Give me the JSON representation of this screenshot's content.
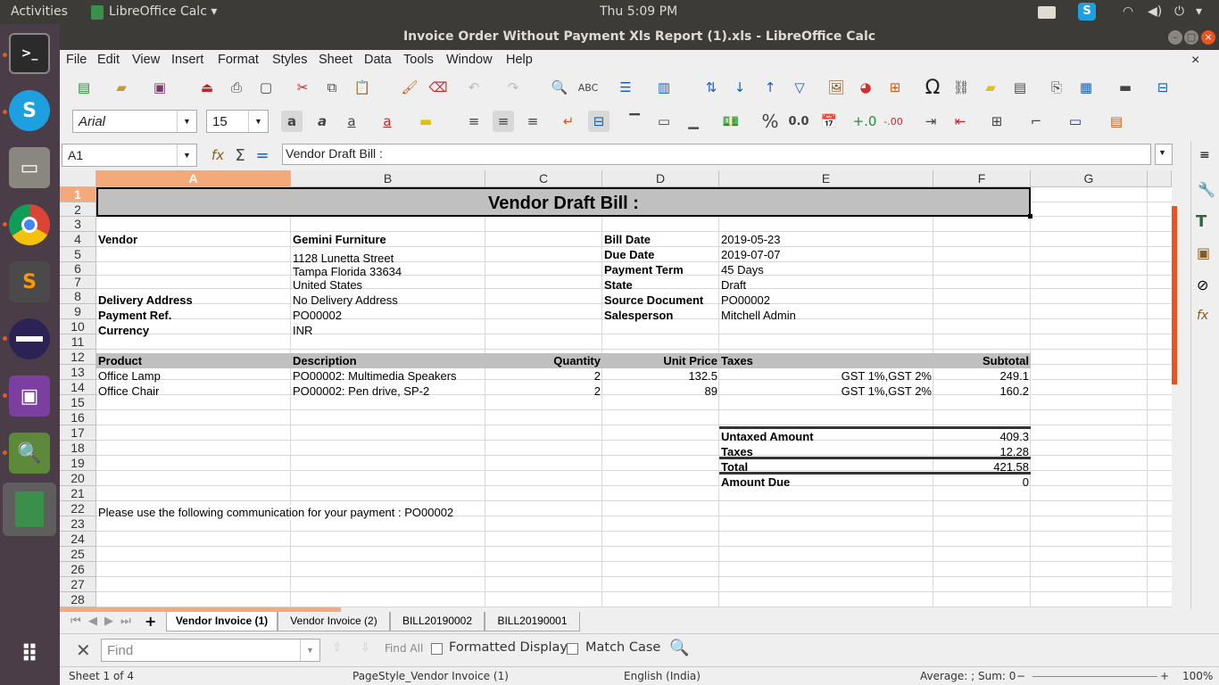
{
  "topbar": {
    "activities": "Activities",
    "app_menu": "LibreOffice Calc ▾",
    "clock": "Thu  5:09 PM"
  },
  "window": {
    "title": "Invoice Order Without Payment Xls Report (1).xls - LibreOffice Calc"
  },
  "menu": [
    "File",
    "Edit",
    "View",
    "Insert",
    "Format",
    "Styles",
    "Sheet",
    "Data",
    "Tools",
    "Window",
    "Help"
  ],
  "font_name": "Arial",
  "font_size": "15",
  "formula_bar": {
    "name_box": "A1",
    "content": "Vendor Draft Bill :"
  },
  "columns": [
    "A",
    "B",
    "C",
    "D",
    "E",
    "F",
    "G"
  ],
  "rows": [
    "1",
    "2",
    "3",
    "4",
    "5",
    "6",
    "7",
    "8",
    "9",
    "10",
    "11",
    "12",
    "13",
    "14",
    "15",
    "16",
    "17",
    "18",
    "19",
    "20",
    "21",
    "22",
    "23",
    "24",
    "25",
    "26",
    "27",
    "28"
  ],
  "sheet": {
    "title": "Vendor Draft Bill :",
    "vendor_label": "Vendor",
    "vendor_name": "Gemini Furniture",
    "address1": "1128 Lunetta Street",
    "address2": "Tampa Florida 33634",
    "address3": "United States",
    "delivery_label": "Delivery Address",
    "delivery_value": "No Delivery Address",
    "payref_label": "Payment Ref.",
    "payref_value": "PO00002",
    "currency_label": "Currency",
    "currency_value": "INR",
    "bill_date_label": "Bill Date",
    "bill_date": "2019-05-23",
    "due_date_label": "Due Date",
    "due_date": "2019-07-07",
    "term_label": "Payment Term",
    "term": "45 Days",
    "state_label": "State",
    "state": "Draft",
    "source_label": "Source Document",
    "source": "PO00002",
    "sales_label": "Salesperson",
    "sales": "Mitchell Admin",
    "headers": {
      "product": "Product",
      "description": "Description",
      "quantity": "Quantity",
      "unit_price": "Unit Price",
      "taxes": "Taxes",
      "subtotal": "Subtotal"
    },
    "lines": [
      {
        "product": "Office Lamp",
        "description": "PO00002: Multimedia Speakers",
        "quantity": "2",
        "unit_price": "132.5",
        "taxes": "GST 1%,GST 2%",
        "subtotal": "249.1"
      },
      {
        "product": "Office Chair",
        "description": "PO00002: Pen drive, SP-2",
        "quantity": "2",
        "unit_price": "89",
        "taxes": "GST 1%,GST 2%",
        "subtotal": "160.2"
      }
    ],
    "totals": [
      {
        "label": "Untaxed Amount",
        "value": "409.3"
      },
      {
        "label": "Taxes",
        "value": "12.28"
      },
      {
        "label": "Total",
        "value": "421.58"
      },
      {
        "label": "Amount Due",
        "value": "0"
      }
    ],
    "note": "Please use the following communication for your payment : PO00002"
  },
  "tabs": [
    "Vendor Invoice (1)",
    "Vendor Invoice (2)",
    "BILL20190002",
    "BILL20190001"
  ],
  "find": {
    "placeholder": "Find",
    "find_all": "Find All",
    "formatted": "Formatted Display",
    "match_case": "Match Case"
  },
  "status": {
    "sheet": "Sheet 1 of 4",
    "page_style": "PageStyle_Vendor Invoice (1)",
    "language": "English (India)",
    "sum": "Average: ; Sum: 0",
    "zoom": "100%"
  },
  "colors": {
    "accent": "#e95420",
    "header_fill": "#c0c0c0"
  }
}
